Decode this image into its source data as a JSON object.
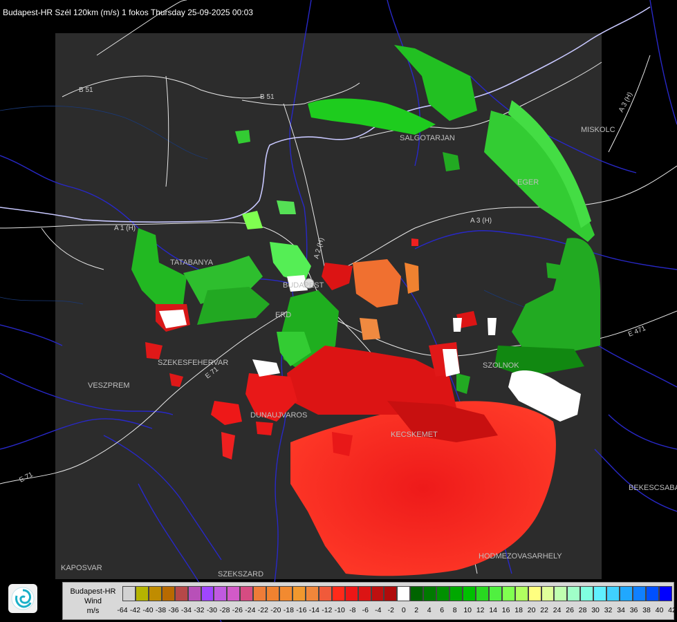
{
  "title": "Budapest-HR Szél 120km (m/s) 1 fokos Thursday 25-09-2025 00:03",
  "cities": [
    {
      "name": "SALGOTARJAN"
    },
    {
      "name": "MISKOLC"
    },
    {
      "name": "EGER"
    },
    {
      "name": "TATABANYA"
    },
    {
      "name": "BUDAPEST"
    },
    {
      "name": "ERD"
    },
    {
      "name": "SZEKESFEHERVAR"
    },
    {
      "name": "VESZPREM"
    },
    {
      "name": "DUNAUJVAROS"
    },
    {
      "name": "KECSKEMET"
    },
    {
      "name": "SZOLNOK"
    },
    {
      "name": "BEKESCSABA"
    },
    {
      "name": "HODMEZOVASARHELY"
    },
    {
      "name": "KAPOSVAR"
    },
    {
      "name": "SZEKSZARD"
    }
  ],
  "roads": [
    {
      "label": "B 51"
    },
    {
      "label": "B 51"
    },
    {
      "label": "A 3 (H)"
    },
    {
      "label": "A 3 (H)"
    },
    {
      "label": "A 1 (H)"
    },
    {
      "label": "A 2 (H)"
    },
    {
      "label": "E 71"
    },
    {
      "label": "E 71"
    },
    {
      "label": "E 471"
    }
  ],
  "legend": {
    "title_line1": "Budapest-HR",
    "title_line2": "Wind",
    "title_line3": "m/s",
    "colors": [
      "#d2d2d2",
      "#b5b400",
      "#c08c00",
      "#b86a00",
      "#b64848",
      "#b850b8",
      "#a046ff",
      "#c05ae0",
      "#d25ac8",
      "#d64c82",
      "#ee7c38",
      "#f08230",
      "#f28a30",
      "#f0982e",
      "#f0863a",
      "#f05a3a",
      "#ff2a1a",
      "#ee1616",
      "#dc1414",
      "#be1010",
      "#b00c0c",
      "#ffffff",
      "#006400",
      "#007a00",
      "#009000",
      "#00a800",
      "#00c000",
      "#28d820",
      "#50f040",
      "#80ff50",
      "#b0ff60",
      "#ffff80",
      "#e0ff9a",
      "#c0ffb0",
      "#a0ffc8",
      "#80ffe0",
      "#60f0ff",
      "#40d0ff",
      "#20a8ff",
      "#1080ff",
      "#0050ff",
      "#0000ff"
    ],
    "ticks": [
      "-64",
      "-42",
      "-40",
      "-38",
      "-36",
      "-34",
      "-32",
      "-30",
      "-28",
      "-26",
      "-24",
      "-22",
      "-20",
      "-18",
      "-16",
      "-14",
      "-12",
      "-10",
      "-8",
      "-6",
      "-4",
      "-2",
      "0",
      "2",
      "4",
      "6",
      "8",
      "10",
      "12",
      "14",
      "16",
      "18",
      "20",
      "22",
      "24",
      "26",
      "28",
      "30",
      "32",
      "34",
      "36",
      "38",
      "40",
      "42"
    ]
  }
}
